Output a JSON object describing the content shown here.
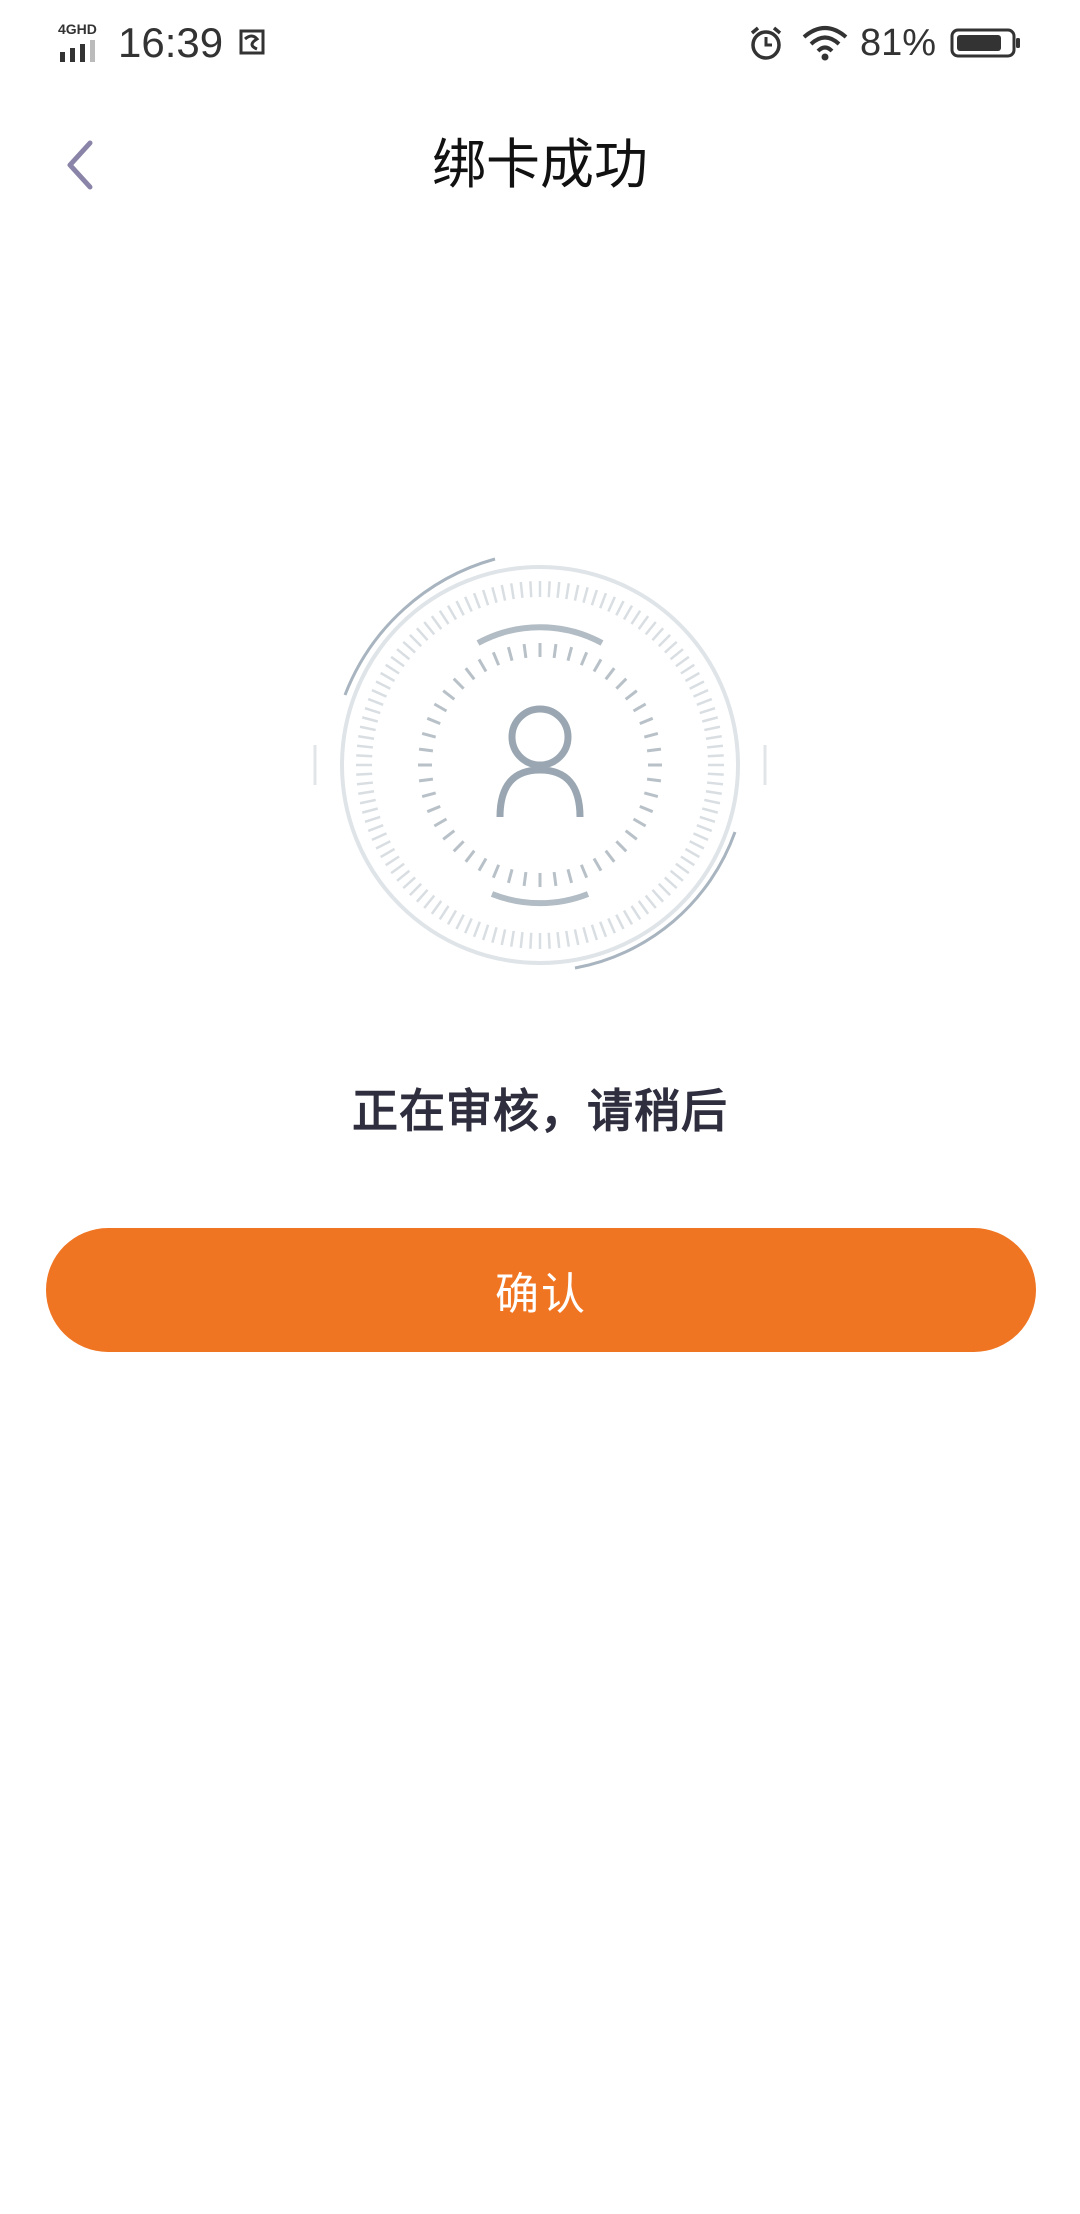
{
  "status_bar": {
    "network": "4GHD",
    "time": "16:39",
    "battery": "81%",
    "icons": [
      "signal-icon",
      "screenshot-icon",
      "alarm-icon",
      "wifi-icon",
      "battery-icon"
    ]
  },
  "nav": {
    "title": "绑卡成功",
    "back_icon": "chevron-left-icon"
  },
  "main": {
    "illustration_icon": "user-avatar-verification-icon",
    "message": "正在审核，请稍后",
    "confirm_label": "确认"
  },
  "colors": {
    "accent": "#f07522",
    "icon_gray": "#9aa7b2",
    "back_arrow": "#8a84a8"
  }
}
